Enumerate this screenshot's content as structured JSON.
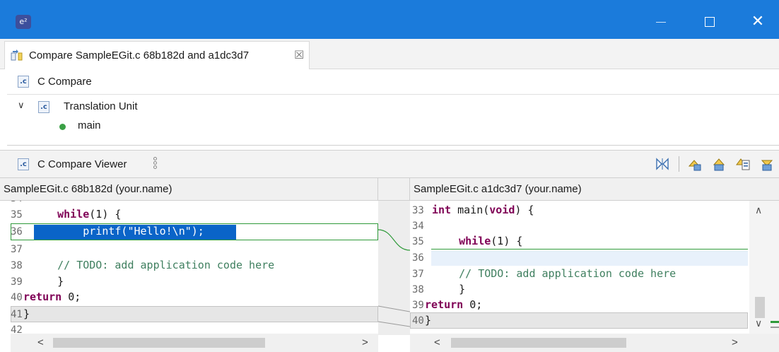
{
  "window": {
    "app_icon": "e²",
    "controls": {
      "minimize": "minimize-icon",
      "maximize": "maximize-icon",
      "close": "✕"
    }
  },
  "editor_tab": {
    "title": "Compare SampleEGit.c 68b182d and a1dc3d7",
    "close": "☒"
  },
  "structure": {
    "header": "C Compare",
    "file_icon": ".c",
    "tree": {
      "expand": "∨",
      "unit_label": "Translation Unit",
      "children": [
        "main"
      ]
    }
  },
  "viewer": {
    "title": "C Compare Viewer",
    "left_header": "SampleEGit.c 68b182d (your.name)",
    "right_header": "SampleEGit.c a1dc3d7 (your.name)",
    "toolbar": [
      "ignore-whitespace-icon",
      "next-difference-icon",
      "previous-difference-icon",
      "next-change-icon",
      "previous-change-icon"
    ]
  },
  "left_code": [
    {
      "ln": "35",
      "code": "    while(1) {"
    },
    {
      "ln": "36",
      "code": "        printf(\"Hello!\\n\");"
    },
    {
      "ln": "37",
      "code": ""
    },
    {
      "ln": "38",
      "code": "    // TODO: add application code here"
    },
    {
      "ln": "39",
      "code": "    }"
    },
    {
      "ln": "40",
      "code": "return 0;"
    },
    {
      "ln": "41",
      "code": "}"
    },
    {
      "ln": "42",
      "code": ""
    }
  ],
  "right_code": [
    {
      "ln": "33",
      "code": "int main(void) {"
    },
    {
      "ln": "34",
      "code": ""
    },
    {
      "ln": "35",
      "code": "    while(1) {"
    },
    {
      "ln": "36",
      "code": ""
    },
    {
      "ln": "37",
      "code": "    // TODO: add application code here"
    },
    {
      "ln": "38",
      "code": "    }"
    },
    {
      "ln": "39",
      "code": "return 0;"
    },
    {
      "ln": "40",
      "code": "}"
    }
  ],
  "scroll": {
    "up": "∧",
    "down": "∨",
    "left": "<",
    "right": ">"
  },
  "colors": {
    "titlebar": "#1b7bdb",
    "selection": "#0a64c8",
    "diff_line": "#2f9a3a",
    "diff_fill": "#e8f1fb",
    "keyword": "#7f0055",
    "comment": "#3f7f5f"
  }
}
